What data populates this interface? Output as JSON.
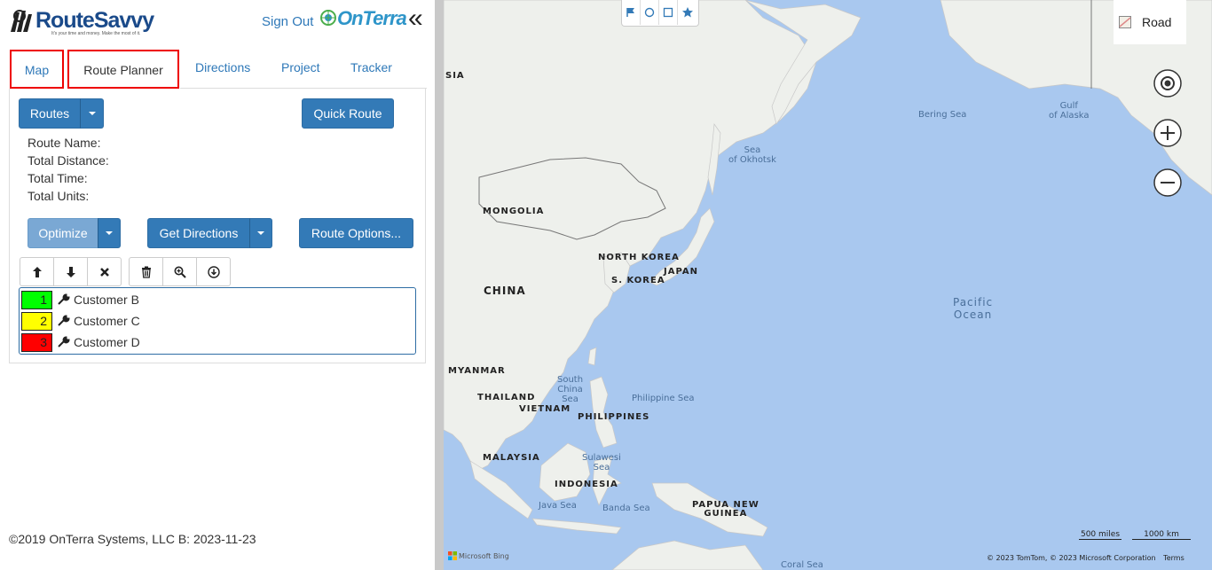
{
  "header": {
    "logo_text": "RouteSavvy",
    "logo_tagline": "It's your time and money. Make the most of it.",
    "sign_out": "Sign Out",
    "brand": "OnTerra",
    "collapse_glyph": "«"
  },
  "tabs": [
    {
      "label": "Map"
    },
    {
      "label": "Route Planner"
    },
    {
      "label": "Directions"
    },
    {
      "label": "Project"
    },
    {
      "label": "Tracker"
    }
  ],
  "buttons": {
    "routes": "Routes",
    "quick_route": "Quick Route",
    "optimize": "Optimize",
    "get_directions": "Get Directions",
    "route_options": "Route Options..."
  },
  "route_info": {
    "name_label": "Route Name:",
    "distance_label": "Total Distance:",
    "time_label": "Total Time:",
    "units_label": "Total Units:"
  },
  "toolbar_icons": [
    "arrow-up-icon",
    "arrow-down-icon",
    "remove-icon",
    "trash-icon",
    "zoom-in-icon",
    "download-icon"
  ],
  "stops": [
    {
      "num": "1",
      "name": "Customer B",
      "color": "#00ff00"
    },
    {
      "num": "2",
      "name": "Customer C",
      "color": "#ffff00"
    },
    {
      "num": "3",
      "name": "Customer D",
      "color": "#ff0000"
    }
  ],
  "footer": "©2019 OnTerra Systems, LLC B: 2023-11-23",
  "map": {
    "style_label": "Road",
    "labels": {
      "sia": "SIA",
      "mongolia": "MONGOLIA",
      "china": "CHINA",
      "north_korea": "NORTH KOREA",
      "south_korea": "S. KOREA",
      "japan": "JAPAN",
      "myanmar": "MYANMAR",
      "thailand": "THAILAND",
      "vietnam": "VIETNAM",
      "philippines": "PHILIPPINES",
      "malaysia": "MALAYSIA",
      "indonesia": "INDONESIA",
      "papua": "PAPUA NEW\nGUINEA"
    },
    "seas": {
      "bering": "Bering Sea",
      "alaska": "Gulf\nof Alaska",
      "okhotsk": "Sea\nof Okhotsk",
      "south_china": "South\nChina\nSea",
      "philippine": "Philippine Sea",
      "sulawesi": "Sulawesi\nSea",
      "java": "Java Sea",
      "banda": "Banda Sea",
      "coral": "Coral Sea",
      "pacific": "Pacific\nOcean"
    },
    "scale_miles": "500 miles",
    "scale_km": "1000 km",
    "attribution": "© 2023 TomTom, © 2023 Microsoft Corporation",
    "terms": "Terms",
    "bing": "Microsoft Bing"
  },
  "colors": {
    "primary": "#337ab7",
    "optimize_disabled": "#7aa8d4",
    "ocean": "#a9c8ef",
    "land": "#eef0ec"
  }
}
